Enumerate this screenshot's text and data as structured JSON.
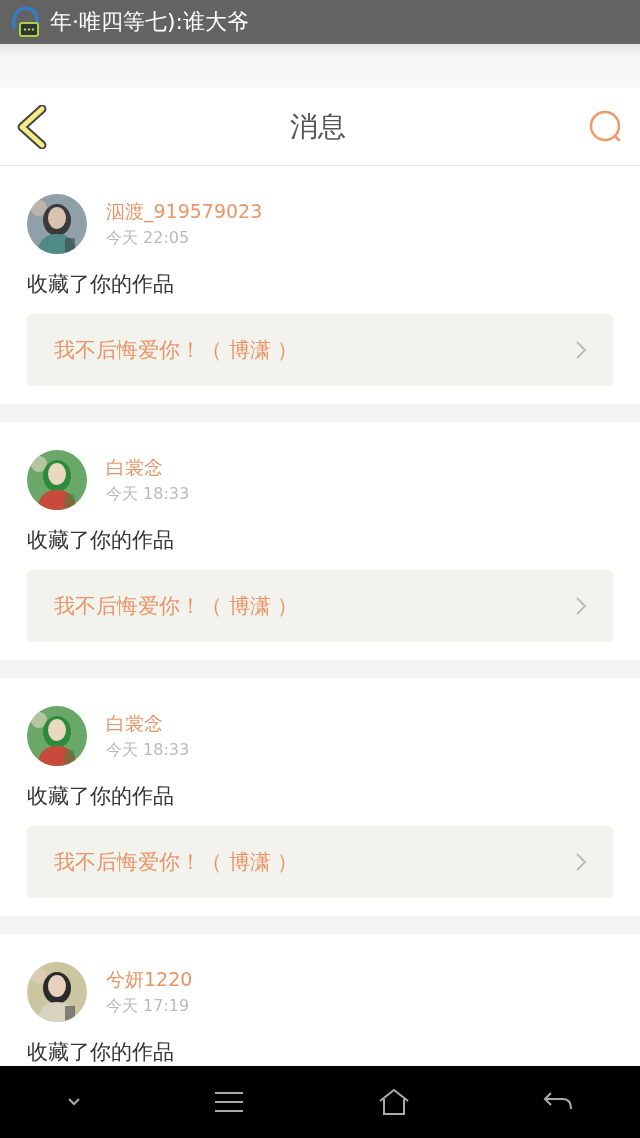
{
  "status_bar": {
    "notification": "年·唯四等七):谁大爷"
  },
  "header": {
    "title": "消息"
  },
  "messages": [
    {
      "name": "泅渡_919579023",
      "time": "今天 22:05",
      "action": "收藏了你的作品",
      "work": "我不后悔爱你！（ 博潇 ）"
    },
    {
      "name": "白裳念",
      "time": "今天 18:33",
      "action": "收藏了你的作品",
      "work": "我不后悔爱你！（ 博潇 ）"
    },
    {
      "name": "白裳念",
      "time": "今天 18:33",
      "action": "收藏了你的作品",
      "work": "我不后悔爱你！（ 博潇 ）"
    },
    {
      "name": "兮妍1220",
      "time": "今天 17:19",
      "action": "收藏了你的作品"
    }
  ]
}
